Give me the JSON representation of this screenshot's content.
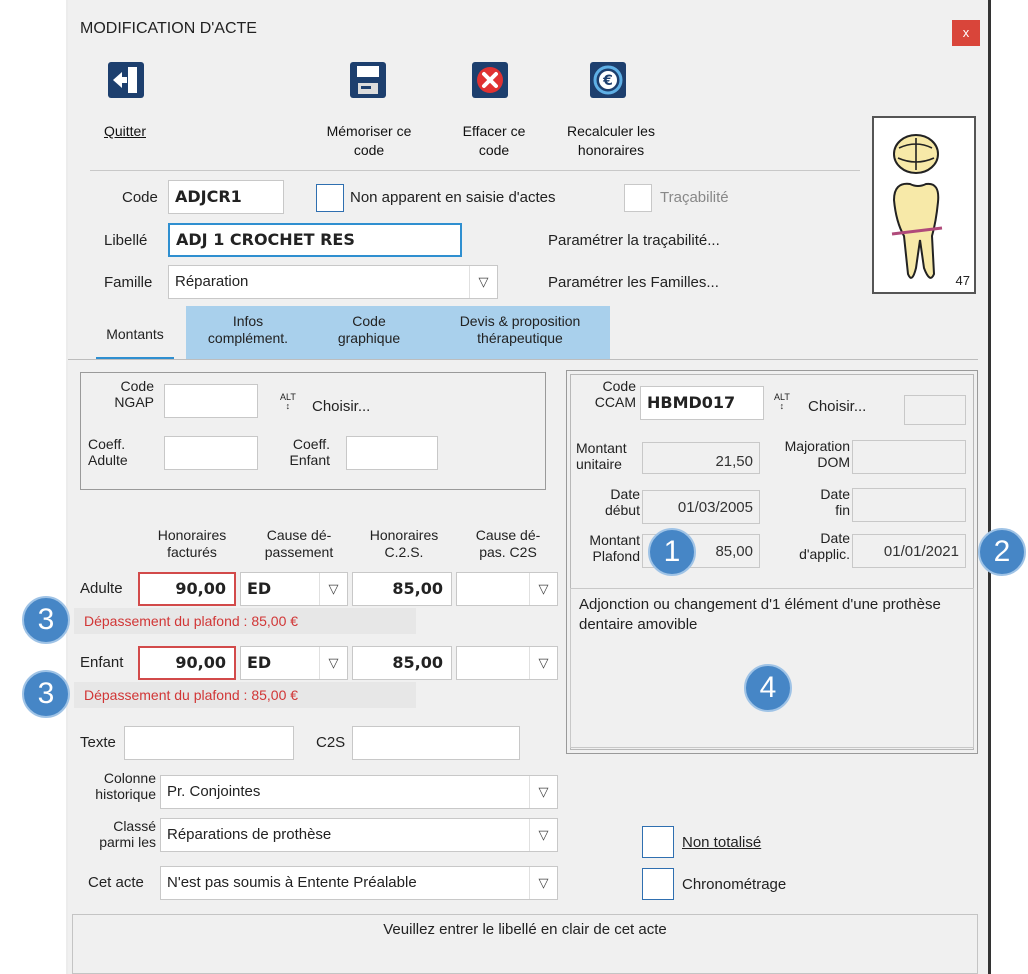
{
  "window": {
    "title": "MODIFICATION D'ACTE",
    "close_label": "x"
  },
  "toolbar": {
    "quit": "Quitter",
    "memorize": [
      "Mémoriser ce",
      "code"
    ],
    "erase": [
      "Effacer ce",
      "code"
    ],
    "recalc": [
      "Recalculer les",
      "honoraires"
    ]
  },
  "tooth": {
    "number": "47"
  },
  "form": {
    "code_label": "Code",
    "code_value": "ADJCR1",
    "non_apparent_label": "Non apparent en saisie d'actes",
    "tracabilite_label": "Traçabilité",
    "libelle_label": "Libellé",
    "libelle_value": "ADJ 1 CROCHET RES",
    "param_trac": "Paramétrer la traçabilité...",
    "famille_label": "Famille",
    "famille_value": "Réparation",
    "param_fam": "Paramétrer les Familles..."
  },
  "tabs": {
    "montants": "Montants",
    "infos": [
      "Infos",
      "complément."
    ],
    "code_graph": [
      "Code",
      "graphique"
    ],
    "devis": [
      "Devis & proposition",
      "thérapeutique"
    ]
  },
  "ngap": {
    "code_label": [
      "Code",
      "NGAP"
    ],
    "choisir": "Choisir...",
    "coeff_adulte": [
      "Coeff.",
      "Adulte"
    ],
    "coeff_enfant": [
      "Coeff.",
      "Enfant"
    ]
  },
  "honoraires": {
    "headers": {
      "h1": [
        "Honoraires",
        "facturés"
      ],
      "h2": [
        "Cause dé-",
        "passement"
      ],
      "h3": [
        "Honoraires",
        "C.2.S."
      ],
      "h4": [
        "Cause dé-",
        "pas. C2S"
      ]
    },
    "adulte": {
      "label": "Adulte",
      "fact": "90,00",
      "cause": "ED",
      "c2s": "85,00",
      "warning": "Dépassement du plafond : 85,00 €"
    },
    "enfant": {
      "label": "Enfant",
      "fact": "90,00",
      "cause": "ED",
      "c2s": "85,00",
      "warning": "Dépassement du plafond : 85,00 €"
    }
  },
  "texte": {
    "texte_label": "Texte",
    "c2s_label": "C2S"
  },
  "selects": {
    "colonne_label": [
      "Colonne",
      "historique"
    ],
    "colonne_value": "Pr. Conjointes",
    "classe_label": [
      "Classé",
      "parmi les"
    ],
    "classe_value": "Réparations de prothèse",
    "acte_label": "Cet acte",
    "acte_value": "N'est pas soumis à Entente Préalable"
  },
  "ccam": {
    "code_label": [
      "Code",
      "CCAM"
    ],
    "code_value": "HBMD017",
    "choisir": "Choisir...",
    "montant_unit_label": [
      "Montant",
      "unitaire"
    ],
    "montant_unit_value": "21,50",
    "majoration_label": [
      "Majoration",
      "DOM"
    ],
    "date_debut_label": [
      "Date",
      "début"
    ],
    "date_debut_value": "01/03/2005",
    "date_fin_label": [
      "Date",
      "fin"
    ],
    "plafond_label": [
      "Montant",
      "Plafond"
    ],
    "plafond_value": "85,00",
    "date_applic_label": [
      "Date",
      "d'applic."
    ],
    "date_applic_value": "01/01/2021",
    "description": "Adjonction ou changement d'1 élément d'une prothèse dentaire amovible"
  },
  "options": {
    "non_totalise": "Non totalisé",
    "chronometrage": "Chronométrage"
  },
  "status": "Veuillez entrer le libellé en clair de cet acte",
  "markers": {
    "m1": "1",
    "m2": "2",
    "m3a": "3",
    "m3b": "3",
    "m4": "4"
  },
  "colors": {
    "tab_blue": "#a9d0ec",
    "focus_blue": "#2f8fd0",
    "error_red": "#d24a4a",
    "marker_blue": "#4686c6"
  }
}
